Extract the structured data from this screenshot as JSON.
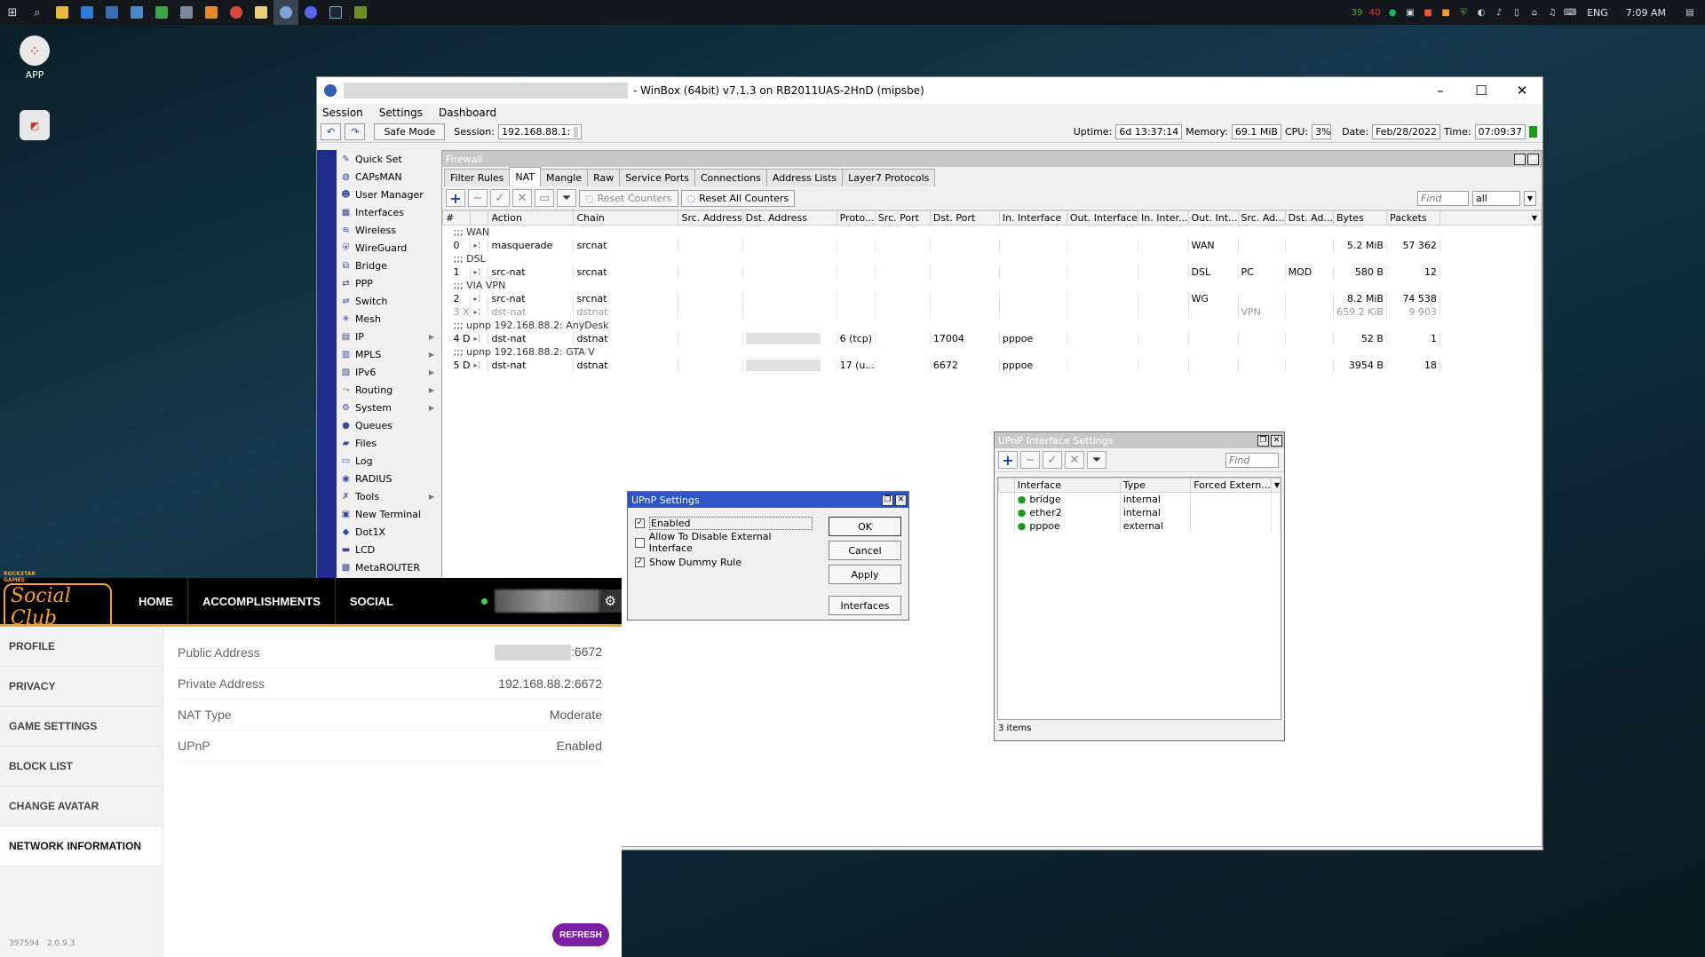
{
  "taskbar": {
    "tray_temp_a": "39",
    "tray_temp_b": "40",
    "language": "ENG",
    "time": "7:09 AM"
  },
  "desktop": {
    "app_label": "APP"
  },
  "winbox": {
    "title": "- WinBox (64bit) v7.1.3 on RB2011UAS-2HnD (mipsbe)",
    "menu": [
      "Session",
      "Settings",
      "Dashboard"
    ],
    "safe_mode": "Safe Mode",
    "session_label": "Session:",
    "session_value": "192.168.88.1:",
    "uptime_label": "Uptime:",
    "uptime": "6d 13:37:14",
    "memory_label": "Memory:",
    "memory": "69.1 MiB",
    "cpu_label": "CPU:",
    "cpu": "3%",
    "date_label": "Date:",
    "date": "Feb/28/2022",
    "time_label": "Time:",
    "time": "07:09:37",
    "sidebar": [
      {
        "label": "Quick Set",
        "icon": "quickset-icon",
        "arrow": false
      },
      {
        "label": "CAPsMAN",
        "icon": "capsman-icon",
        "arrow": false
      },
      {
        "label": "User Manager",
        "icon": "users-icon",
        "arrow": false
      },
      {
        "label": "Interfaces",
        "icon": "interfaces-icon",
        "arrow": false
      },
      {
        "label": "Wireless",
        "icon": "wireless-icon",
        "arrow": false
      },
      {
        "label": "WireGuard",
        "icon": "wireguard-icon",
        "arrow": false
      },
      {
        "label": "Bridge",
        "icon": "bridge-icon",
        "arrow": false
      },
      {
        "label": "PPP",
        "icon": "ppp-icon",
        "arrow": false
      },
      {
        "label": "Switch",
        "icon": "switch-icon",
        "arrow": false
      },
      {
        "label": "Mesh",
        "icon": "mesh-icon",
        "arrow": false
      },
      {
        "label": "IP",
        "icon": "ip-icon",
        "arrow": true
      },
      {
        "label": "MPLS",
        "icon": "mpls-icon",
        "arrow": true
      },
      {
        "label": "IPv6",
        "icon": "ipv6-icon",
        "arrow": true
      },
      {
        "label": "Routing",
        "icon": "routing-icon",
        "arrow": true
      },
      {
        "label": "System",
        "icon": "system-icon",
        "arrow": true
      },
      {
        "label": "Queues",
        "icon": "queues-icon",
        "arrow": false
      },
      {
        "label": "Files",
        "icon": "files-icon",
        "arrow": false
      },
      {
        "label": "Log",
        "icon": "log-icon",
        "arrow": false
      },
      {
        "label": "RADIUS",
        "icon": "radius-icon",
        "arrow": false
      },
      {
        "label": "Tools",
        "icon": "tools-icon",
        "arrow": true
      },
      {
        "label": "New Terminal",
        "icon": "terminal-icon",
        "arrow": false
      },
      {
        "label": "Dot1X",
        "icon": "dot1x-icon",
        "arrow": false
      },
      {
        "label": "LCD",
        "icon": "lcd-icon",
        "arrow": false
      },
      {
        "label": "MetaROUTER",
        "icon": "metarouter-icon",
        "arrow": false
      }
    ]
  },
  "firewall": {
    "title": "Firewall",
    "tabs": [
      "Filter Rules",
      "NAT",
      "Mangle",
      "Raw",
      "Service Ports",
      "Connections",
      "Address Lists",
      "Layer7 Protocols"
    ],
    "active_tab": "NAT",
    "reset_counters": "Reset Counters",
    "reset_all_counters": "Reset All Counters",
    "find_placeholder": "Find",
    "filter_value": "all",
    "columns": [
      "#",
      "Action",
      "Chain",
      "Src. Address",
      "Dst. Address",
      "Proto...",
      "Src. Port",
      "Dst. Port",
      "In. Interface",
      "Out. Interface",
      "In. Inter...",
      "Out. Int...",
      "Src. Ad...",
      "Dst. Ad...",
      "Bytes",
      "Packets"
    ],
    "rows": [
      {
        "kind": "comment",
        "text": ";;; WAN"
      },
      {
        "kind": "rule",
        "cells": [
          "0",
          "masquerade",
          "srcnat",
          "",
          "",
          "",
          "",
          "",
          "",
          "",
          "",
          "WAN",
          "",
          "",
          "5.2 MiB",
          "57 362"
        ]
      },
      {
        "kind": "comment",
        "text": ";;; DSL"
      },
      {
        "kind": "rule",
        "cells": [
          "1",
          "src-nat",
          "srcnat",
          "",
          "",
          "",
          "",
          "",
          "",
          "",
          "",
          "DSL",
          "PC",
          "MOD",
          "580 B",
          "12"
        ]
      },
      {
        "kind": "comment",
        "text": ";;; VIA VPN"
      },
      {
        "kind": "rule",
        "cells": [
          "2",
          "src-nat",
          "srcnat",
          "",
          "",
          "",
          "",
          "",
          "",
          "",
          "",
          "WG",
          "",
          "",
          "8.2 MiB",
          "74 538"
        ]
      },
      {
        "kind": "disabled",
        "cells": [
          "3 X",
          "dst-nat",
          "dstnat",
          "",
          "",
          "",
          "",
          "",
          "",
          "",
          "",
          "",
          "VPN",
          "",
          "659.2 KiB",
          "9 903"
        ]
      },
      {
        "kind": "comment",
        "text": ";;; upnp 192.168.88.2: AnyDesk"
      },
      {
        "kind": "rule",
        "blur": true,
        "cells": [
          "4 D",
          "dst-nat",
          "dstnat",
          "",
          "",
          "6 (tcp)",
          "",
          "17004",
          "pppoe",
          "",
          "",
          "",
          "",
          "",
          "52 B",
          "1"
        ]
      },
      {
        "kind": "comment",
        "text": ";;; upnp 192.168.88.2: GTA V"
      },
      {
        "kind": "rule",
        "blur": true,
        "cells": [
          "5 D",
          "dst-nat",
          "dstnat",
          "",
          "",
          "17 (u...",
          "",
          "6672",
          "pppoe",
          "",
          "",
          "",
          "",
          "",
          "3954 B",
          "18"
        ]
      }
    ]
  },
  "upnp_settings": {
    "title": "UPnP Settings",
    "enabled_label": "Enabled",
    "enabled_checked": true,
    "allow_disable_label": "Allow To Disable External Interface",
    "allow_disable_checked": false,
    "dummy_rule_label": "Show Dummy Rule",
    "dummy_rule_checked": true,
    "ok": "OK",
    "cancel": "Cancel",
    "apply": "Apply",
    "interfaces": "Interfaces"
  },
  "upnp_interfaces": {
    "title": "UPnP Interface Settings",
    "find_placeholder": "Find",
    "columns": [
      "Interface",
      "Type",
      "Forced Extern..."
    ],
    "rows": [
      {
        "interface": "bridge",
        "type": "internal"
      },
      {
        "interface": "ether2",
        "type": "internal"
      },
      {
        "interface": "pppoe",
        "type": "external"
      }
    ],
    "count": "3 items"
  },
  "social_club": {
    "logo_top": "ROCKSTAR GAMES",
    "logo": "Social Club",
    "nav": [
      "HOME",
      "ACCOMPLISHMENTS",
      "SOCIAL"
    ],
    "side": [
      "PROFILE",
      "PRIVACY",
      "GAME SETTINGS",
      "BLOCK LIST",
      "CHANGE AVATAR",
      "NETWORK INFORMATION"
    ],
    "active_side": "NETWORK INFORMATION",
    "info": [
      {
        "label": "Public Address",
        "value": ":6672"
      },
      {
        "label": "Private Address",
        "value": "192.168.88.2:6672"
      },
      {
        "label": "NAT Type",
        "value": "Moderate"
      },
      {
        "label": "UPnP",
        "value": "Enabled"
      }
    ],
    "version": "397594   2.0.9.3",
    "refresh": "REFRESH",
    "accent": "#f7a12d"
  }
}
